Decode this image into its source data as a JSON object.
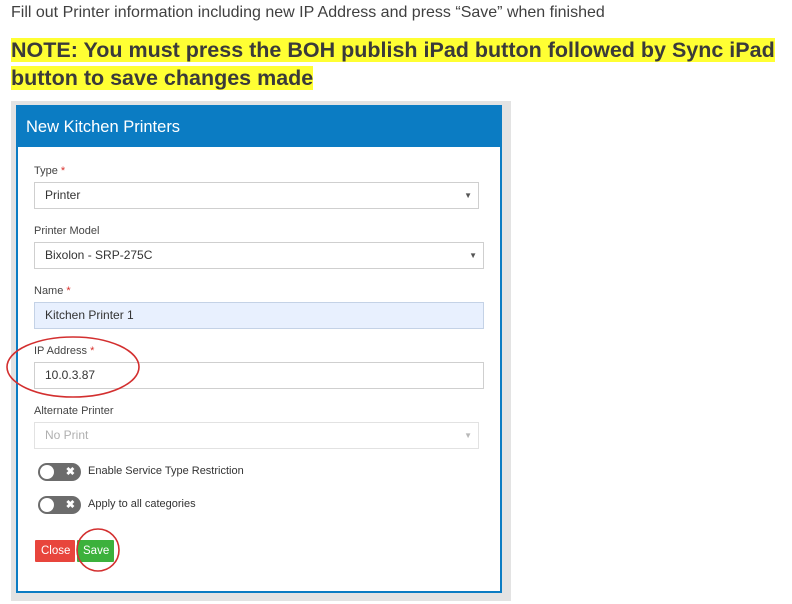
{
  "intro_text": "Fill out Printer information including new IP Address and press “Save” when finished",
  "note_text": "NOTE: You must press the BOH publish iPad button followed by Sync iPad button to save changes made",
  "colors": {
    "header": "#0b7cc3",
    "highlight": "#ffff33",
    "close_button": "#e8453c",
    "save_button": "#3cb13c",
    "annotation": "#d32f2f"
  },
  "dialog": {
    "title": "New Kitchen Printers",
    "required_mark": "*",
    "fields": {
      "type": {
        "label": "Type",
        "value": "Printer"
      },
      "printer_model": {
        "label": "Printer Model",
        "value": "Bixolon - SRP-275C"
      },
      "name": {
        "label": "Name",
        "value": "Kitchen Printer 1"
      },
      "ip_address": {
        "label": "IP Address",
        "value": "10.0.3.87"
      },
      "alternate_printer": {
        "label": "Alternate Printer",
        "value": "No Print"
      }
    },
    "toggles": [
      {
        "label": "Enable Service Type Restriction",
        "on": false,
        "off_glyph": "✖"
      },
      {
        "label": "Apply to all categories",
        "on": false,
        "off_glyph": "✖"
      }
    ],
    "buttons": {
      "close": "Close",
      "save": "Save"
    },
    "caret_glyph": "▼"
  }
}
